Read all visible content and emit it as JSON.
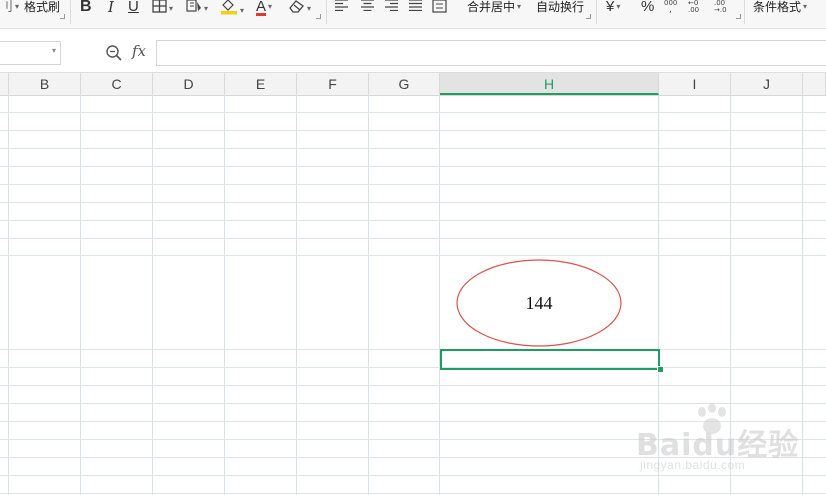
{
  "ribbon": {
    "format_painter": "格式刷",
    "merge_center": "合并居中",
    "auto_wrap": "自动换行",
    "currency_symbol": "¥",
    "percent_symbol": "%",
    "conditional_format": "条件格式",
    "bold_glyph": "B",
    "italic_glyph": "I",
    "underline_glyph": "U",
    "font_color_glyph": "A"
  },
  "formula_bar": {
    "fx_label": "fx",
    "name_box_value": "",
    "formula_value": ""
  },
  "columns": [
    "B",
    "C",
    "D",
    "E",
    "F",
    "G",
    "H",
    "I",
    "J"
  ],
  "active_column": "H",
  "shape": {
    "type": "ellipse",
    "text": "144",
    "stroke_color": "#d9534f"
  },
  "selection_color": "#1f9d63",
  "watermark": {
    "brand": "Baidu经验",
    "url": "jingyan.baidu.com"
  }
}
